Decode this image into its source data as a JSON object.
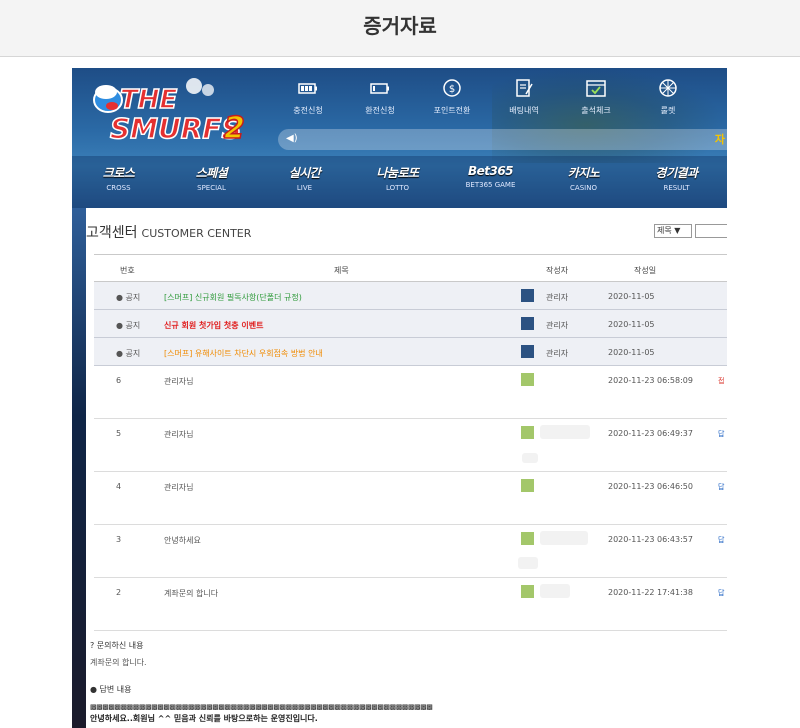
{
  "page": {
    "title": "증거자료"
  },
  "site": {
    "logo_text": "THE SMURFS2",
    "icons": [
      {
        "label": "충전신청",
        "icon": "battery-full-icon"
      },
      {
        "label": "환전신청",
        "icon": "battery-empty-icon"
      },
      {
        "label": "포인트전환",
        "icon": "coin-exchange-icon"
      },
      {
        "label": "배팅내역",
        "icon": "document-edit-icon"
      },
      {
        "label": "출석체크",
        "icon": "calendar-check-icon"
      },
      {
        "label": "룰렛",
        "icon": "roulette-wheel-icon"
      }
    ],
    "ticker_more": "자",
    "menu": [
      {
        "label": "크로스",
        "sub": "CROSS"
      },
      {
        "label": "스페셜",
        "sub": "SPECIAL"
      },
      {
        "label": "실시간",
        "sub": "LIVE"
      },
      {
        "label": "나눔로또",
        "sub": "LOTTO"
      },
      {
        "label": "Bet365",
        "sub": "BET365 GAME"
      },
      {
        "label": "카지노",
        "sub": "CASINO"
      },
      {
        "label": "경기결과",
        "sub": "RESULT"
      }
    ]
  },
  "board": {
    "title": "고객센터",
    "title_en": "CUSTOMER CENTER",
    "search_option": "제목",
    "headers": {
      "no": "번호",
      "title": "제목",
      "author": "작성자",
      "date": "작성일"
    },
    "notices": [
      {
        "no": "공지",
        "title": "[스머프] 신규회원 필독사항(단폴더 규정)",
        "author": "관리자",
        "date": "2020-11-05"
      },
      {
        "no": "공지",
        "title": "신규 회원 첫가입 첫충 이벤트",
        "author": "관리자",
        "date": "2020-11-05"
      },
      {
        "no": "공지",
        "title": "[스머프] 유해사이트 차단시 우회접속 방법 안내",
        "author": "관리자",
        "date": "2020-11-05"
      }
    ],
    "posts": [
      {
        "no": "6",
        "title": "관리자님",
        "date": "2020-11-23 06:58:09",
        "extra": "접"
      },
      {
        "no": "5",
        "title": "관리자님",
        "date": "2020-11-23 06:49:37",
        "extra": "답"
      },
      {
        "no": "4",
        "title": "관리자님",
        "date": "2020-11-23 06:46:50",
        "extra": "답"
      },
      {
        "no": "3",
        "title": "안녕하세요",
        "date": "2020-11-23 06:43:57",
        "extra": "답"
      },
      {
        "no": "2",
        "title": "계좌문의 합니다",
        "date": "2020-11-22 17:41:38",
        "extra": "답"
      }
    ]
  },
  "detail": {
    "question_label": "? 문의하신 내용",
    "question_text": "계좌문의 합니다.",
    "answer_label": "답변 내용",
    "answer_line1": "▩▩▩▩▩▩▩▩▩▩▩▩▩▩▩▩▩▩▩▩▩▩▩▩▩▩▩▩▩▩▩▩▩▩▩▩▩▩▩▩▩▩▩▩▩▩▩▩▩▩▩▩▩▩▩▩",
    "answer_line2": "안녕하세요..회원님 ^^ 믿음과 신뢰를 바탕으로하는 운영진입니다."
  },
  "colors": {
    "notice_green": "#2f9a3a",
    "notice_red": "#e02020",
    "notice_orange": "#f08a00",
    "author_blue": "#2c5282",
    "author_green": "#a3c76a"
  }
}
